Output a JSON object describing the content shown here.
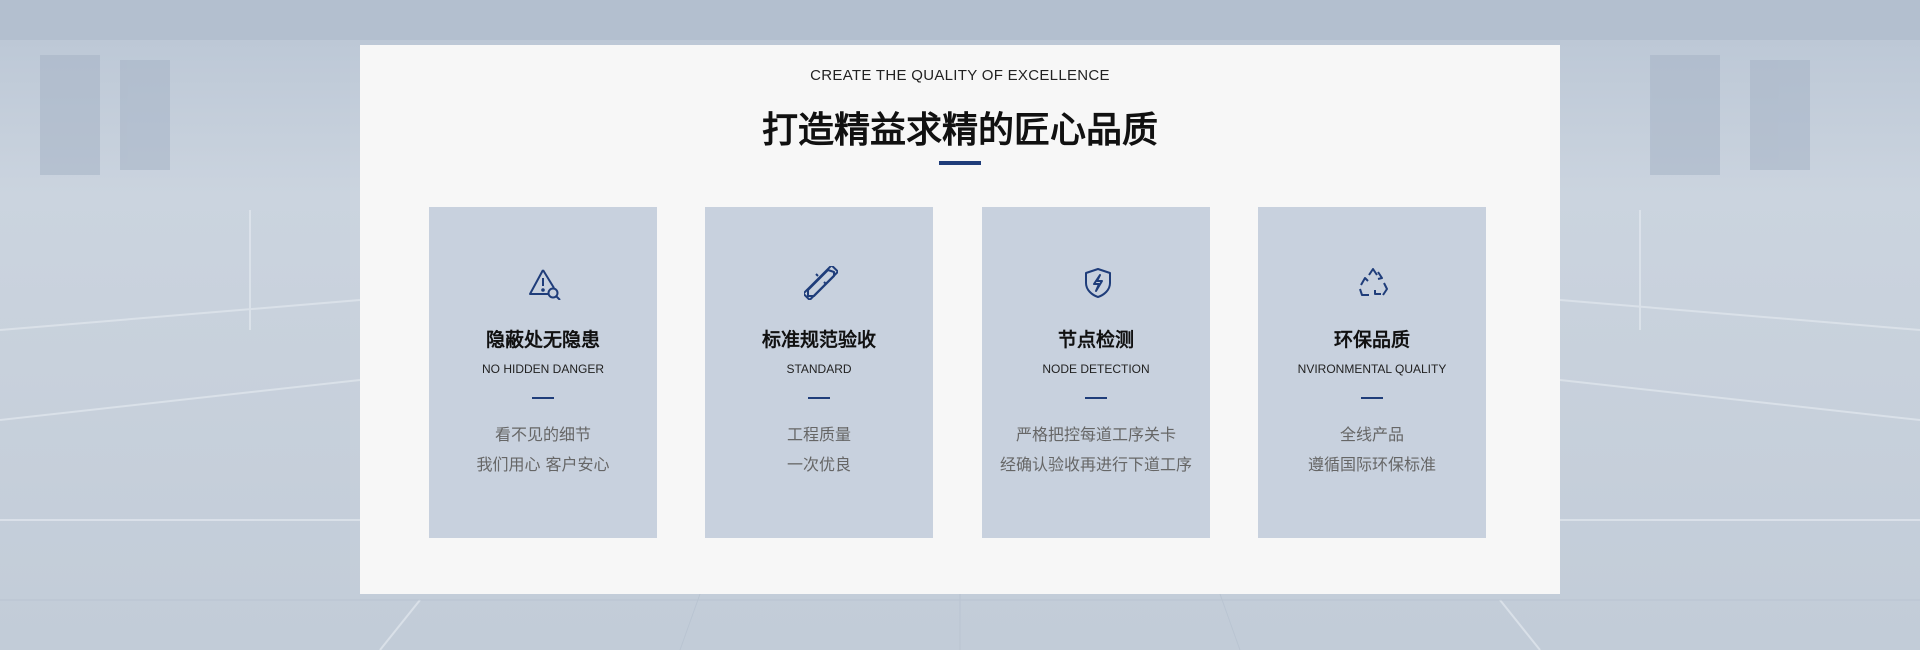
{
  "header": {
    "subtitle": "CREATE THE QUALITY OF EXCELLENCE",
    "title": "打造精益求精的匠心品质"
  },
  "features": [
    {
      "icon": "warning-search-icon",
      "title": "隐蔽处无隐患",
      "subtitle": "NO HIDDEN DANGER",
      "line1": "看不见的细节",
      "line2": "我们用心 客户安心"
    },
    {
      "icon": "ruler-pencil-icon",
      "title": "标准规范验收",
      "subtitle": "STANDARD",
      "line1": "工程质量",
      "line2": "一次优良"
    },
    {
      "icon": "shield-bolt-icon",
      "title": "节点检测",
      "subtitle": "NODE DETECTION",
      "line1": "严格把控每道工序关卡",
      "line2": "经确认验收再进行下道工序"
    },
    {
      "icon": "recycle-icon",
      "title": "环保品质",
      "subtitle": "NVIRONMENTAL QUALITY",
      "line1": "全线产品",
      "line2": "遵循国际环保标准"
    }
  ],
  "colors": {
    "accent": "#1f3d7a",
    "card_bg": "#c8d1de",
    "panel_bg": "#f7f7f7"
  }
}
